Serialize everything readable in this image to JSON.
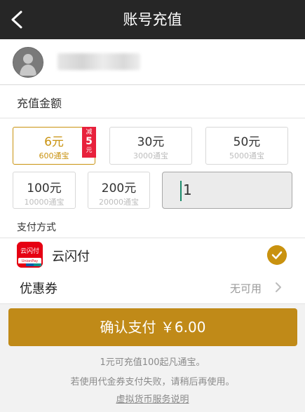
{
  "header": {
    "title": "账号充值"
  },
  "recharge": {
    "amount_label": "充值金额"
  },
  "options": [
    {
      "yuan": "6元",
      "coins": "600通宝",
      "badge_top": "减",
      "badge_num": "5",
      "badge_bottom": "元"
    },
    {
      "yuan": "30元",
      "coins": "3000通宝"
    },
    {
      "yuan": "50元",
      "coins": "5000通宝"
    },
    {
      "yuan": "100元",
      "coins": "10000通宝"
    },
    {
      "yuan": "200元",
      "coins": "20000通宝"
    }
  ],
  "custom_amount": {
    "value": "1"
  },
  "payment": {
    "label": "支付方式",
    "method": "云闪付",
    "icon_text": "云闪付",
    "icon_sub": "UnionPay"
  },
  "coupon": {
    "label": "优惠券",
    "value": "无可用"
  },
  "confirm": {
    "label": "确认支付 ￥6.00"
  },
  "notes": {
    "rate": "1元可充值100起凡通宝。",
    "warning": "若使用代金券支付失败，请稍后再使用。",
    "link": "虚拟货币服务说明"
  },
  "colors": {
    "accent": "#c9920f",
    "header_bg": "#262626",
    "discount_badge": "#e8213c",
    "unionpay": "#e60012"
  }
}
